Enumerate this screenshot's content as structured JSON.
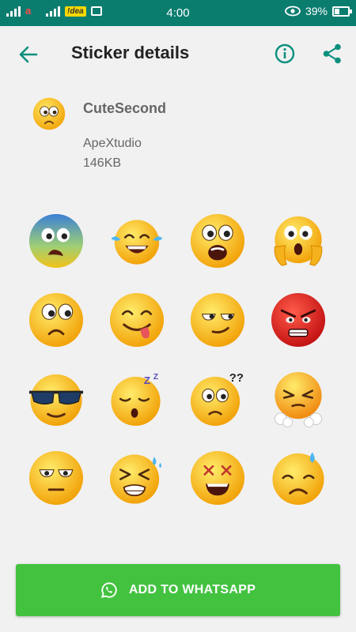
{
  "status_bar": {
    "carrier_badge": "!dea",
    "time": "4:00",
    "battery": "39%"
  },
  "app_bar": {
    "title": "Sticker details",
    "back_icon": "arrow-left-icon",
    "info_icon": "info-icon",
    "share_icon": "share-icon"
  },
  "pack": {
    "name": "CuteSecond",
    "publisher": "ApeXtudio",
    "size": "146KB"
  },
  "stickers": [
    {
      "name": "sticker-cold-worried"
    },
    {
      "name": "sticker-tears-of-joy"
    },
    {
      "name": "sticker-shocked"
    },
    {
      "name": "sticker-screaming-hands"
    },
    {
      "name": "sticker-sad-eyes"
    },
    {
      "name": "sticker-tongue-out"
    },
    {
      "name": "sticker-smirk"
    },
    {
      "name": "sticker-angry-red"
    },
    {
      "name": "sticker-sunglasses"
    },
    {
      "name": "sticker-sleepy"
    },
    {
      "name": "sticker-confused"
    },
    {
      "name": "sticker-steam-angry"
    },
    {
      "name": "sticker-unamused"
    },
    {
      "name": "sticker-sweat-tired"
    },
    {
      "name": "sticker-dizzy"
    },
    {
      "name": "sticker-cold-sweat"
    }
  ],
  "action": {
    "label": "ADD TO WHATSAPP",
    "icon": "whatsapp-icon"
  },
  "colors": {
    "status_bar": "#0a7d6f",
    "accent": "#0b8f7d",
    "button": "#43c240",
    "background": "#f1f1f1"
  }
}
